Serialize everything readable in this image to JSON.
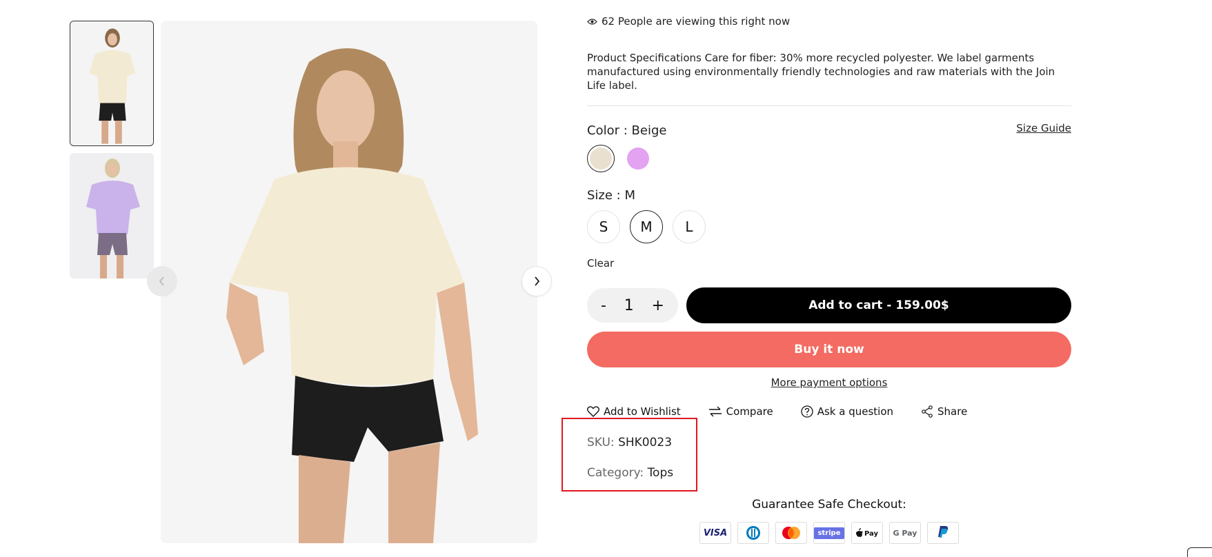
{
  "gallery": {
    "thumbnails": [
      {
        "name": "Beige oversized tee thumbnail"
      },
      {
        "name": "Lilac oversized tee thumbnail"
      }
    ]
  },
  "product": {
    "viewing_text": "62 People are viewing this right now",
    "description": "Product Specifications Care for fiber: 30% more recycled polyester. We label garments manufactured using environmentally friendly technologies and raw materials with the Join Life label.",
    "color_label": "Color : ",
    "color_value": "Beige",
    "size_guide": "Size Guide",
    "colors": [
      {
        "name": "Beige",
        "hex": "#e9e0cf",
        "selected": true
      },
      {
        "name": "Lilac",
        "hex": "#e3a2f2",
        "selected": false
      }
    ],
    "size_label": "Size : ",
    "size_value": "M",
    "sizes": [
      {
        "label": "S",
        "selected": false
      },
      {
        "label": "M",
        "selected": true
      },
      {
        "label": "L",
        "selected": false
      }
    ],
    "clear": "Clear",
    "quantity": {
      "minus": "-",
      "value": "1",
      "plus": "+"
    },
    "add_to_cart": "Add to cart - 159.00$",
    "buy_now": "Buy it now",
    "more_payment": "More payment options",
    "actions": {
      "wishlist": "Add to Wishlist",
      "compare": "Compare",
      "ask": "Ask a question",
      "share": "Share"
    },
    "sku_label": "SKU:",
    "sku_value": "SHK0023",
    "category_label": "Category:",
    "category_value": "Tops",
    "guarantee": "Guarantee Safe Checkout:",
    "payments": [
      "VISA",
      "Diners",
      "Mastercard",
      "stripe",
      "Apple Pay",
      "G Pay",
      "PayPal"
    ]
  },
  "colors": {
    "accent_buy": "#f36b62",
    "cart_bg": "#000000",
    "highlight_box": "#e0161e"
  }
}
